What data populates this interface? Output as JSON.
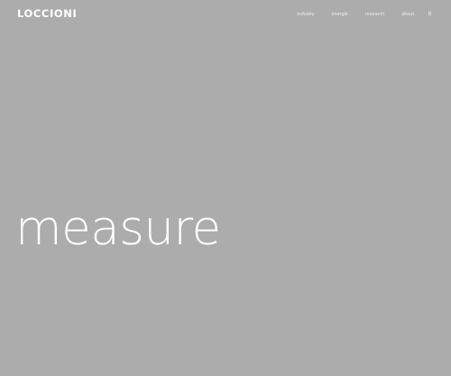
{
  "header": {
    "logo": "LOCCIONI",
    "nav": [
      {
        "label": "industry"
      },
      {
        "label": "energie"
      },
      {
        "label": "research"
      },
      {
        "label": "about"
      }
    ],
    "lang": "it"
  },
  "hero": {
    "word": "measure"
  },
  "colors": {
    "background": "#acacac",
    "text": "#ffffff"
  }
}
